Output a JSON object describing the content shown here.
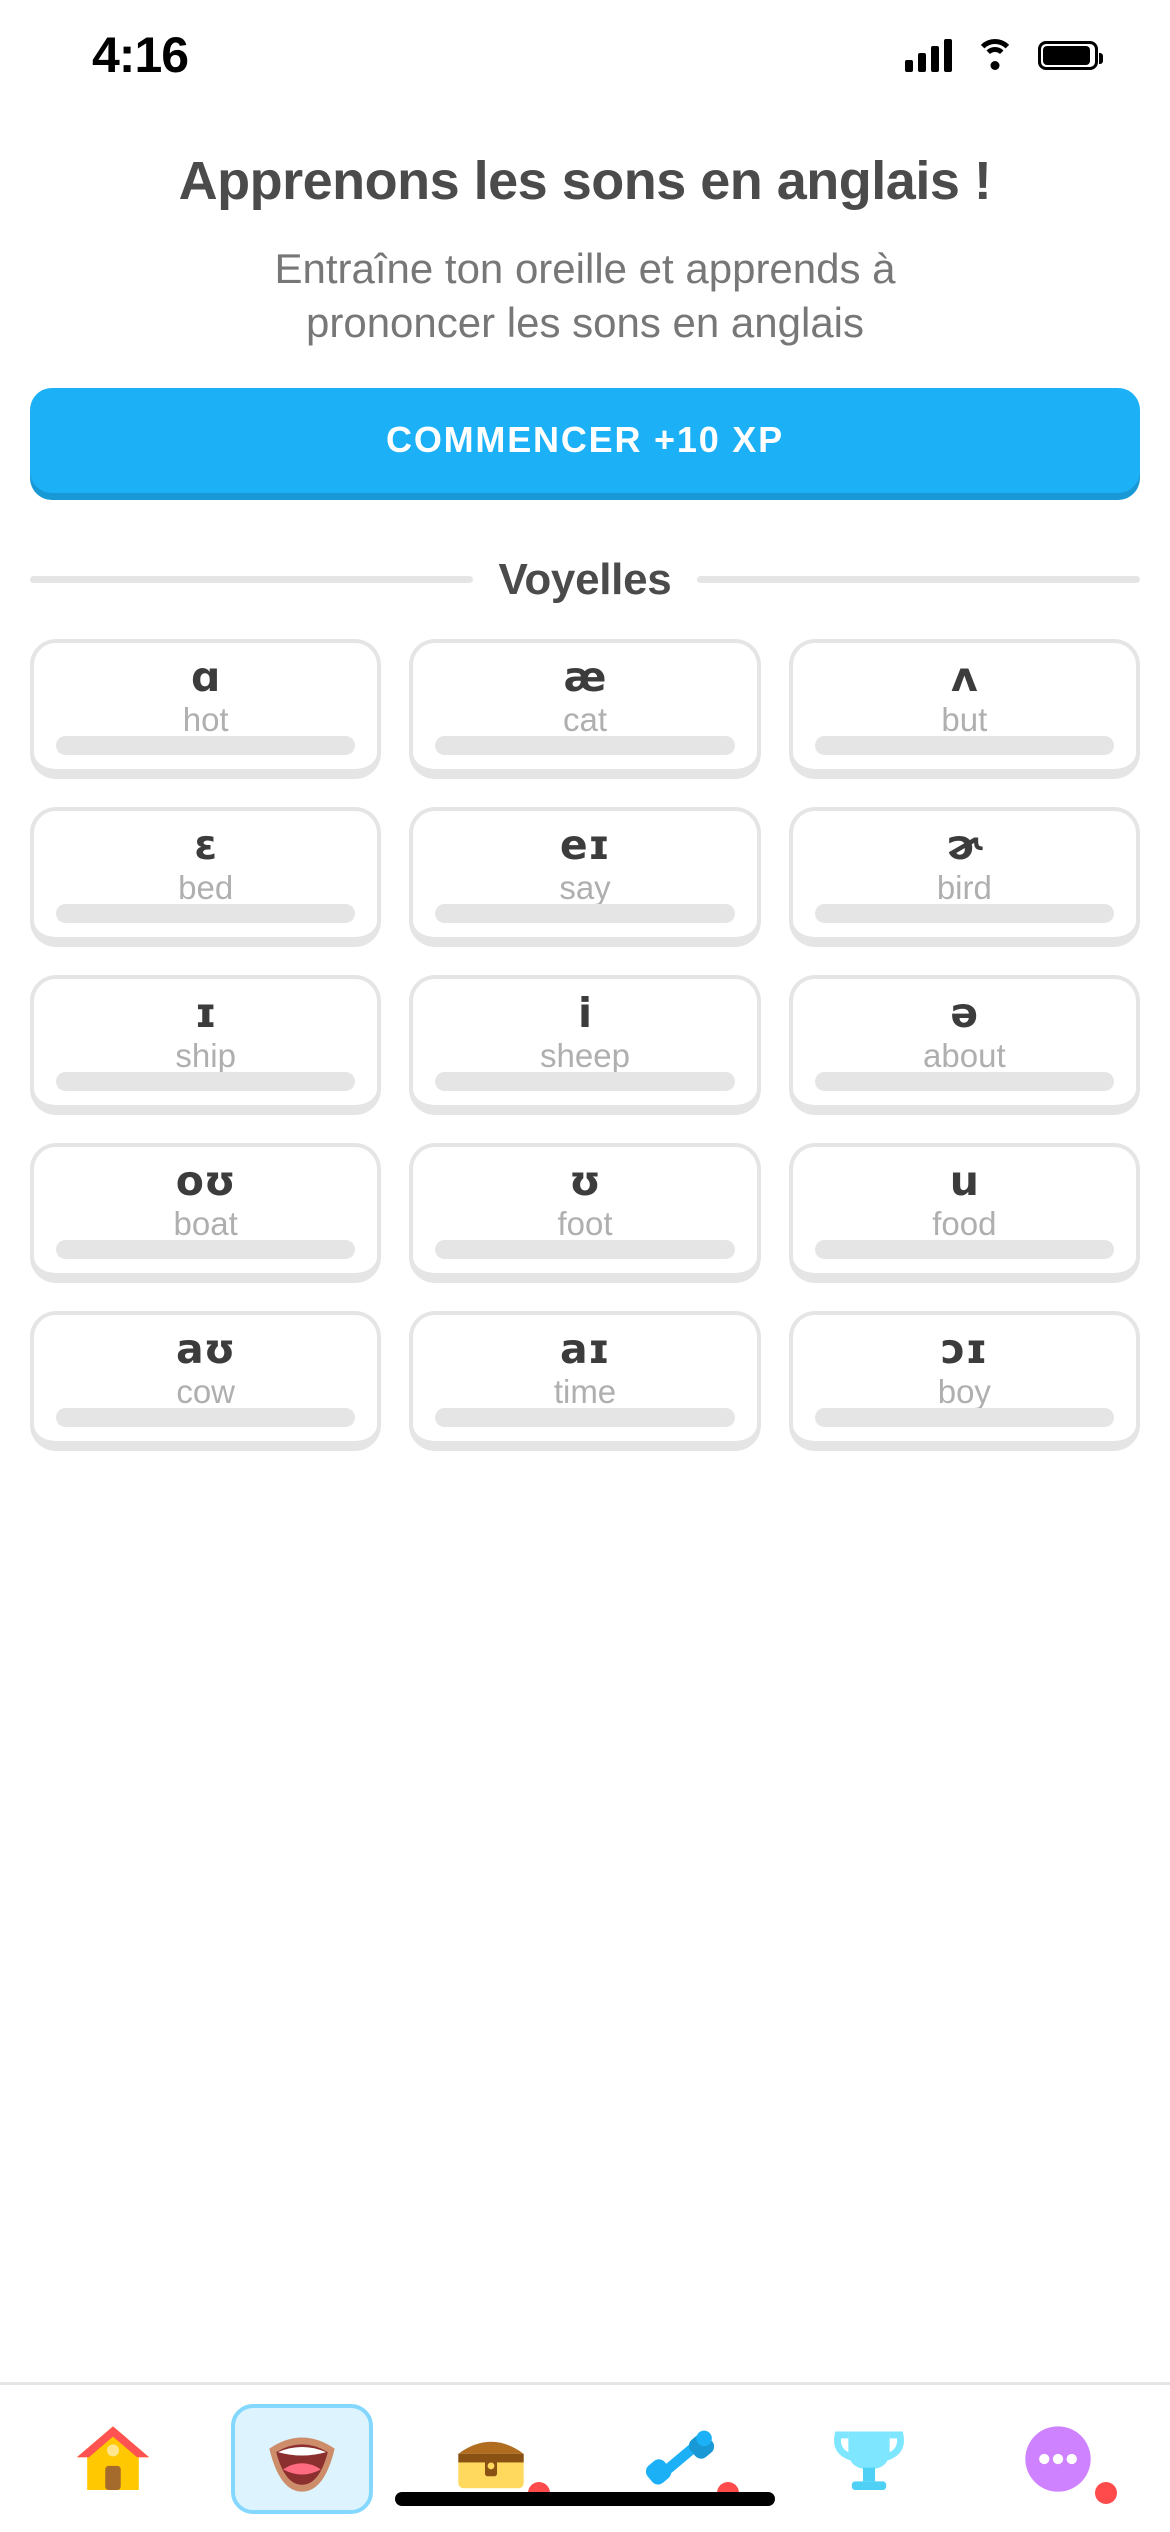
{
  "status_bar": {
    "time": "4:16",
    "signal_icon": "signal-bars-icon",
    "wifi_icon": "wifi-icon",
    "battery_icon": "battery-icon"
  },
  "header": {
    "title": "Apprenons les sons en anglais !",
    "subtitle_line1": "Entraîne ton oreille et apprends à",
    "subtitle_line2": "prononcer les sons en anglais"
  },
  "cta": {
    "label": "COMMENCER +10 XP",
    "color": "#1cb0f6",
    "shadow_color": "#1899d6",
    "text_color": "#ffffff"
  },
  "section": {
    "title": "Voyelles",
    "divider_color": "#e5e5e5"
  },
  "colors": {
    "title_text": "#4b4b4b",
    "subtitle_text": "#777777",
    "card_border": "#e5e5e5",
    "symbol_text": "#3c3c3c",
    "word_text": "#afafaf",
    "progress_track": "#e5e5e5"
  },
  "cards": [
    {
      "symbol": "ɑ",
      "word": "hot",
      "progress": 0
    },
    {
      "symbol": "æ",
      "word": "cat",
      "progress": 0
    },
    {
      "symbol": "ʌ",
      "word": "but",
      "progress": 0
    },
    {
      "symbol": "ɛ",
      "word": "bed",
      "progress": 0
    },
    {
      "symbol": "eɪ",
      "word": "say",
      "progress": 0
    },
    {
      "symbol": "ɚ",
      "word": "bird",
      "progress": 0
    },
    {
      "symbol": "ɪ",
      "word": "ship",
      "progress": 0
    },
    {
      "symbol": "i",
      "word": "sheep",
      "progress": 0
    },
    {
      "symbol": "ə",
      "word": "about",
      "progress": 0
    },
    {
      "symbol": "oʊ",
      "word": "boat",
      "progress": 0
    },
    {
      "symbol": "ʊ",
      "word": "foot",
      "progress": 0
    },
    {
      "symbol": "u",
      "word": "food",
      "progress": 0
    },
    {
      "symbol": "aʊ",
      "word": "cow",
      "progress": 0
    },
    {
      "symbol": "aɪ",
      "word": "time",
      "progress": 0
    },
    {
      "symbol": "ɔɪ",
      "word": "boy",
      "progress": 0
    }
  ],
  "bottom_nav": {
    "items": [
      {
        "name": "nav-home",
        "icon": "house-icon",
        "active": false,
        "badge": false
      },
      {
        "name": "nav-sounds",
        "icon": "mouth-icon",
        "active": true,
        "badge": false
      },
      {
        "name": "nav-treasure",
        "icon": "treasure-chest-icon",
        "active": false,
        "badge": true
      },
      {
        "name": "nav-practice",
        "icon": "dumbbell-icon",
        "active": false,
        "badge": true
      },
      {
        "name": "nav-leagues",
        "icon": "trophy-icon",
        "active": false,
        "badge": false
      },
      {
        "name": "nav-more",
        "icon": "more-dots-icon",
        "active": false,
        "badge": true
      }
    ]
  }
}
